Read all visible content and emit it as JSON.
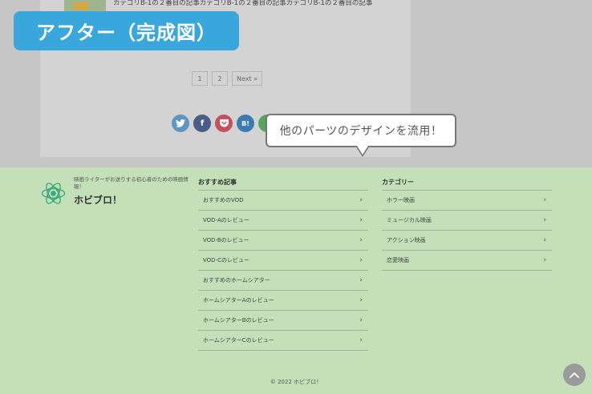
{
  "badge": {
    "label": "アフター（完成図）"
  },
  "article": {
    "title": "カテゴリB-1の２番目の記事カテゴリB-1の２番目の記事カテゴリB-1の２番目の記事"
  },
  "pagination": {
    "pages": [
      "1",
      "2"
    ],
    "next_label": "Next »"
  },
  "share": {
    "twitter": "twitter-icon",
    "facebook": "f",
    "pocket": "pocket-icon",
    "hatena": "B!",
    "line": "line-icon"
  },
  "callout": {
    "text": "他のパーツのデザインを流用！"
  },
  "footer": {
    "site_description": "映画ライターがお送りする初心者のための映画情報！",
    "site_name": "ホビブロ！",
    "recommended": {
      "title": "おすすめ記事",
      "items": [
        "おすすめのVOD",
        "VOD-Aのレビュー",
        "VOD-Bのレビュー",
        "VOD-Cのレビュー",
        "おすすめのホームシアター",
        "ホームシアターAのレビュー",
        "ホームシアターBのレビュー",
        "ホームシアターCのレビュー"
      ]
    },
    "categories": {
      "title": "カテゴリー",
      "items": [
        "ホラー映画",
        "ミュージカル映画",
        "アクション映画",
        "恋愛映画"
      ]
    },
    "copyright": "© 2022 ホビブロ！"
  },
  "colors": {
    "badge": "#3aa7dc",
    "footer_bg": "#c3e0b9",
    "overlay_bg": "#c6c6c6"
  }
}
